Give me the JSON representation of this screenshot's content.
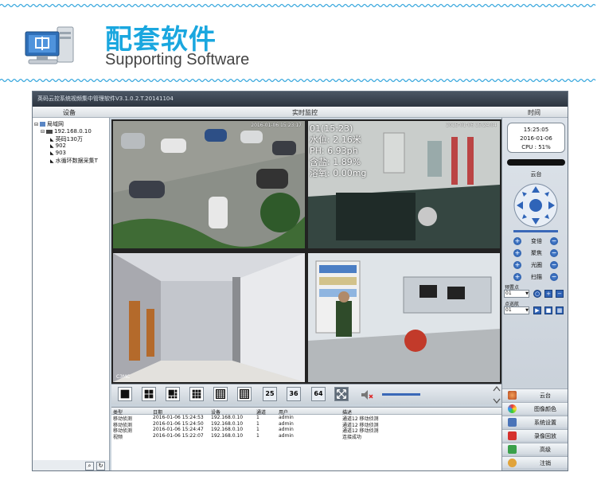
{
  "page": {
    "title_cn": "配套软件",
    "title_en": "Supporting Software"
  },
  "app": {
    "window_title": "英码云控系统视频集中管理软件V3.1.0.2.T.20141104",
    "headers": {
      "devices": "设备",
      "live": "实时监控",
      "time": "时间"
    },
    "tree": {
      "root": "局域网",
      "ip": "192.168.0.10",
      "children": [
        "英码130万",
        "902",
        "903",
        "水循环数据采集T"
      ]
    },
    "cameras": {
      "cam1": {
        "time": "2016-01-06 15:23:17"
      },
      "cam2": {
        "time": "2015-01-06 15:24:04",
        "overlay": [
          "01(15:23)",
          "水位: 2.16米",
          "PH: 6.93ph",
          "含盐: 1.89%",
          "溶氧: 0.00mg"
        ]
      },
      "cam3": {
        "label": "C3MC"
      },
      "cam4": {
        "time": ""
      }
    },
    "toolbar": {
      "layouts": [
        "25",
        "36",
        "64"
      ]
    },
    "events": {
      "columns": [
        "类型",
        "日期",
        "设备",
        "通道",
        "用户",
        "描述"
      ],
      "rows": [
        [
          "移动侦测",
          "2016-01-06 15:24:53",
          "192.168.0.10",
          "1",
          "admin",
          "通道12 移动侦测"
        ],
        [
          "移动侦测",
          "2016-01-06 15:24:50",
          "192.168.0.10",
          "1",
          "admin",
          "通道12 移动侦测"
        ],
        [
          "移动侦测",
          "2016-01-06 15:24:47",
          "192.168.0.10",
          "1",
          "admin",
          "通道12 移动侦测"
        ],
        [
          "视频",
          "2016-01-06 15:22:07",
          "192.168.0.10",
          "1",
          "admin",
          "连接成功"
        ]
      ]
    },
    "right": {
      "clock_time": "15:25:05",
      "clock_date": "2016-01-06",
      "cpu": "CPU : 51%",
      "ptz_label": "云台",
      "ptz_controls": [
        "变倍",
        "聚焦",
        "光圈",
        "扫描"
      ],
      "preset_label": "预置点",
      "preset_value": "01",
      "cruise_label": "点巡航",
      "cruise_value": "01",
      "menu": [
        "云台",
        "图像颜色",
        "系统设置",
        "录像回放",
        "高级",
        "注销"
      ]
    }
  }
}
